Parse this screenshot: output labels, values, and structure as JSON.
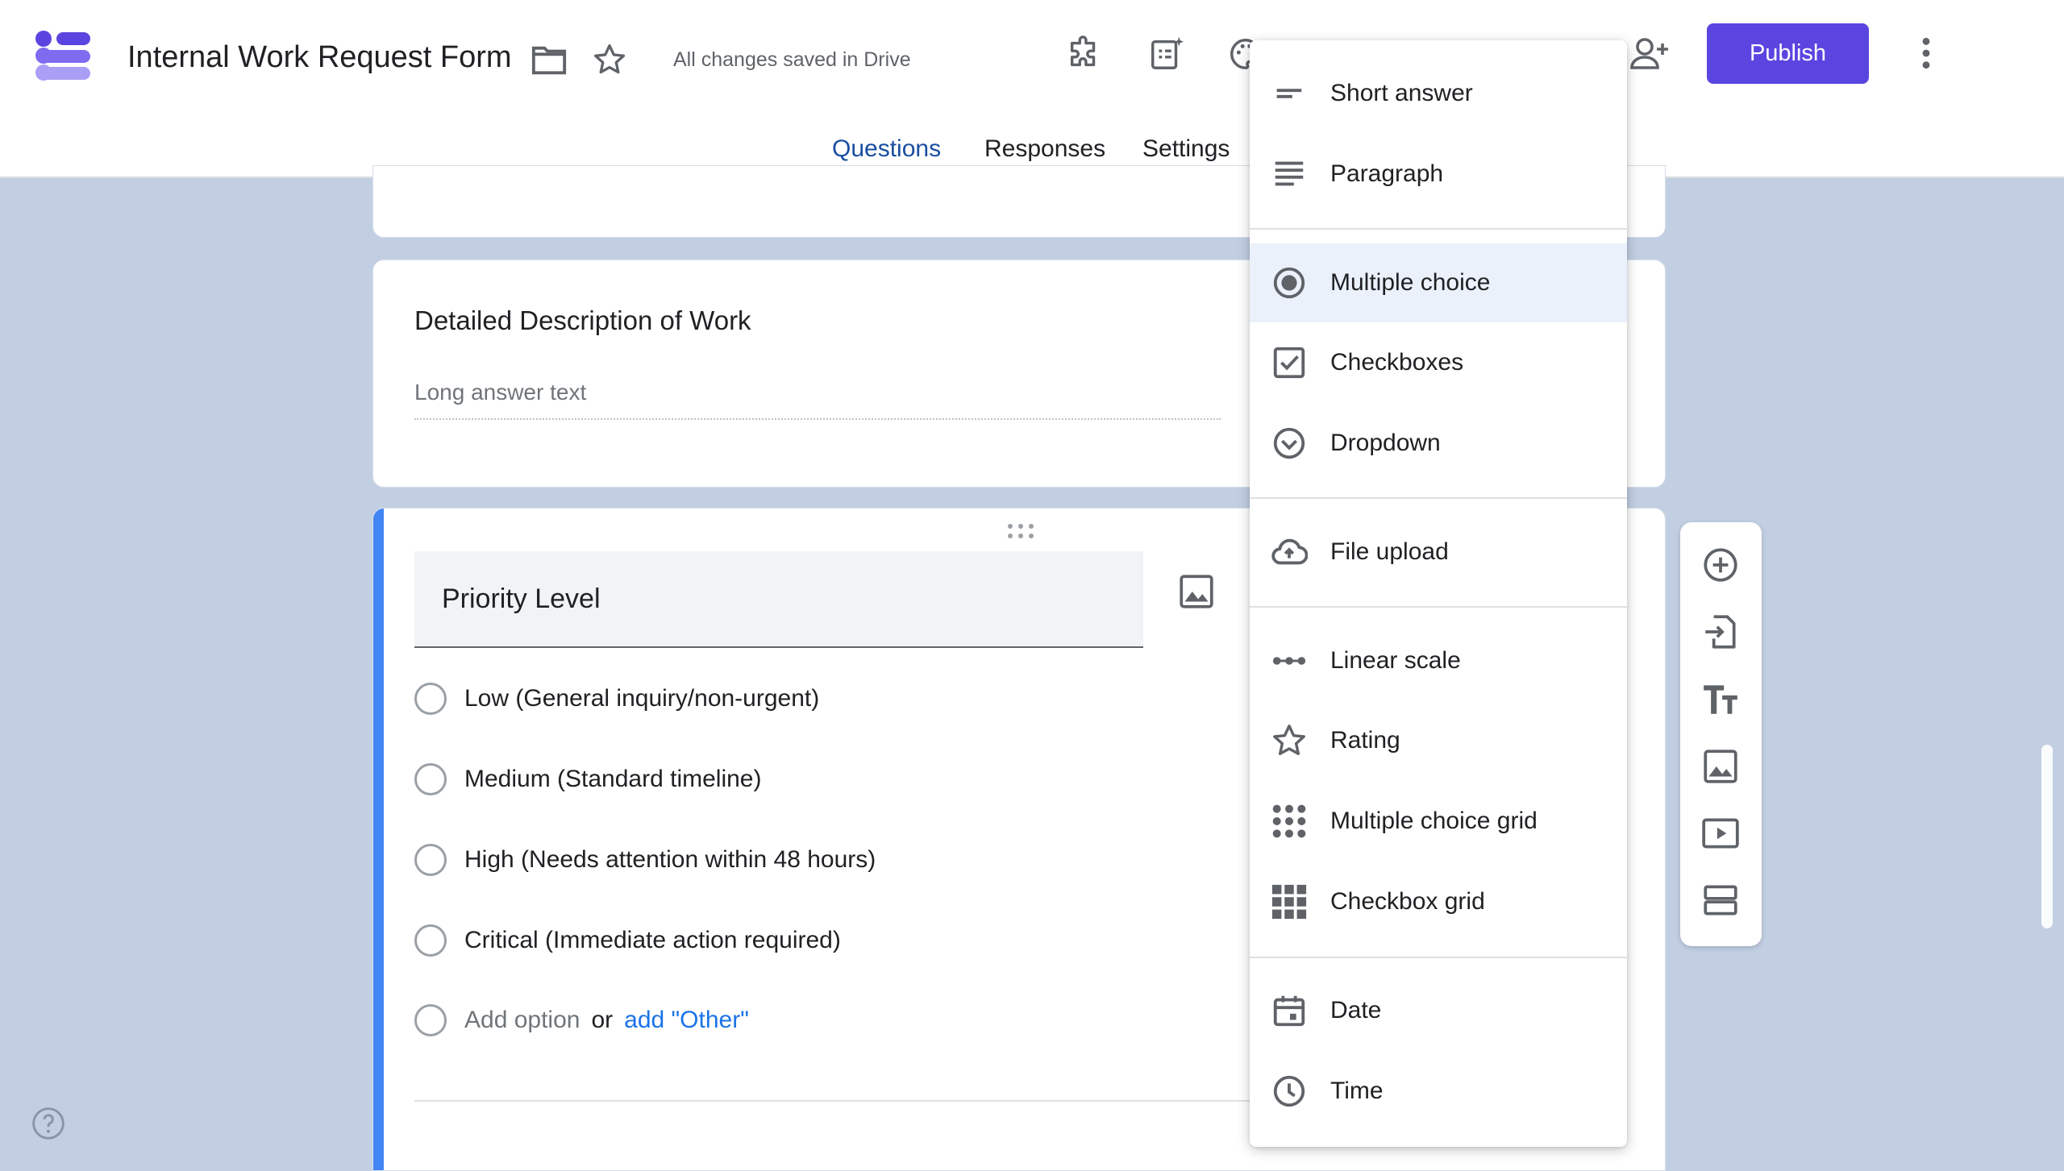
{
  "header": {
    "title": "Internal Work Request Form",
    "save_status": "All changes saved in Drive",
    "publish_label": "Publish",
    "accent_color": "#5b45e0",
    "icons": [
      "forms-logo-icon",
      "folder-icon",
      "star-icon",
      "addon-puzzle-icon",
      "ai-form-icon",
      "palette-icon",
      "add-collaborator-icon",
      "more-vert-icon"
    ]
  },
  "tabs": [
    {
      "label": "Questions",
      "active": true
    },
    {
      "label": "Responses",
      "active": false
    },
    {
      "label": "Settings",
      "active": false
    }
  ],
  "description_card": {
    "title": "Detailed Description of Work",
    "placeholder": "Long answer text"
  },
  "priority_card": {
    "title": "Priority Level",
    "options": [
      "Low (General inquiry/non-urgent)",
      "Medium (Standard timeline)",
      "High (Needs attention within 48 hours)",
      "Critical (Immediate action required)"
    ],
    "add_option": "Add option",
    "or": "or",
    "add_other": "add \"Other\"",
    "accent_color": "#4285f4"
  },
  "question_type_menu": {
    "selected": "Multiple choice",
    "items": [
      {
        "label": "Short answer",
        "icon": "short-answer-icon"
      },
      {
        "label": "Paragraph",
        "icon": "paragraph-icon"
      },
      {
        "label": "Multiple choice",
        "icon": "radio-button-icon"
      },
      {
        "label": "Checkboxes",
        "icon": "checkbox-icon"
      },
      {
        "label": "Dropdown",
        "icon": "dropdown-circle-icon"
      },
      {
        "label": "File upload",
        "icon": "cloud-upload-icon"
      },
      {
        "label": "Linear scale",
        "icon": "linear-scale-icon"
      },
      {
        "label": "Rating",
        "icon": "star-icon"
      },
      {
        "label": "Multiple choice grid",
        "icon": "radio-grid-icon"
      },
      {
        "label": "Checkbox grid",
        "icon": "checkbox-grid-icon"
      },
      {
        "label": "Date",
        "icon": "calendar-icon"
      },
      {
        "label": "Time",
        "icon": "clock-icon"
      }
    ]
  },
  "side_toolbar": [
    "add-question-icon",
    "import-questions-icon",
    "add-title-icon",
    "add-image-icon",
    "add-video-icon",
    "add-section-icon"
  ]
}
